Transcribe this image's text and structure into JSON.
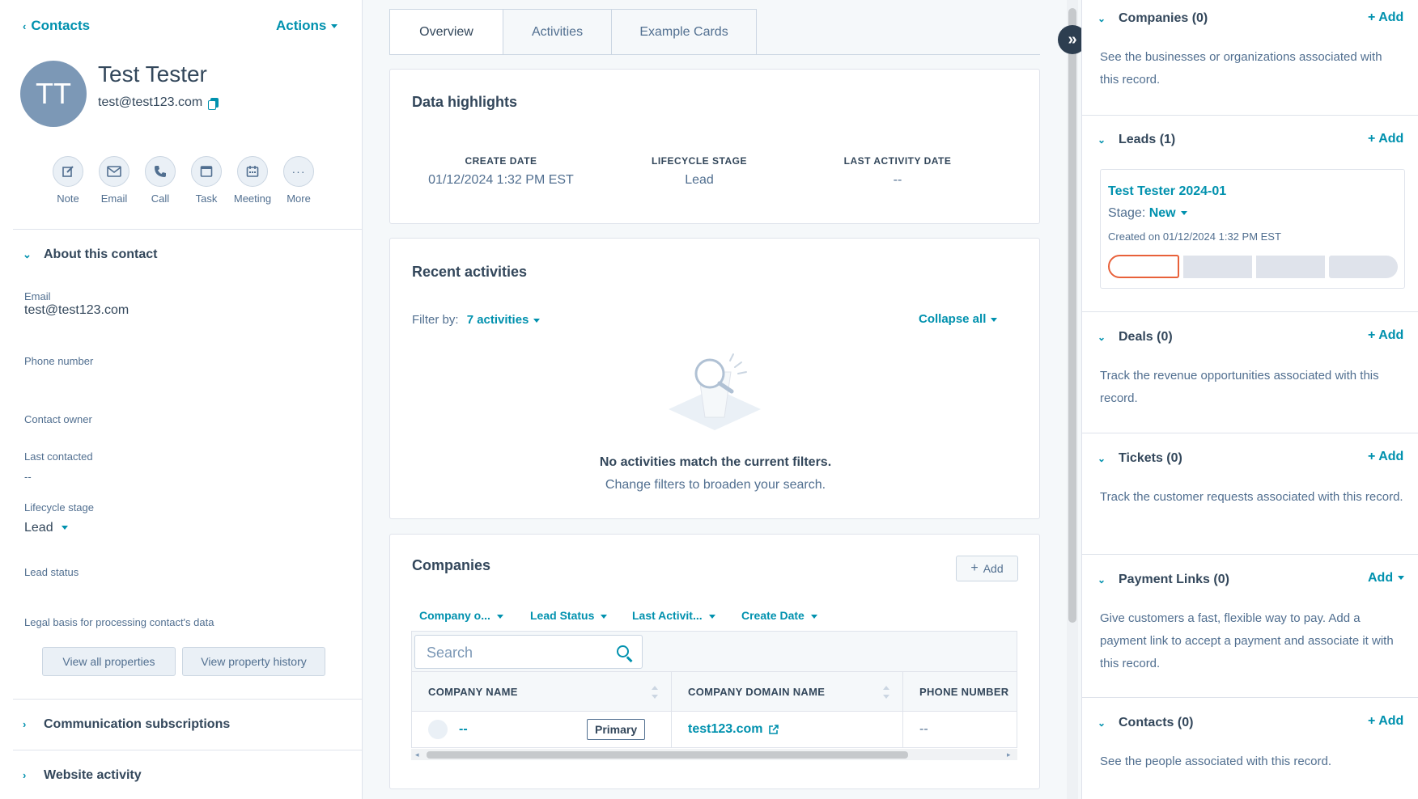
{
  "left": {
    "breadcrumb": "Contacts",
    "actions": "Actions",
    "avatar_initials": "TT",
    "name": "Test Tester",
    "email": "test@test123.com",
    "quick_actions": [
      {
        "label": "Note",
        "icon": "note-edit-icon"
      },
      {
        "label": "Email",
        "icon": "email-icon"
      },
      {
        "label": "Call",
        "icon": "phone-icon"
      },
      {
        "label": "Task",
        "icon": "task-icon"
      },
      {
        "label": "Meeting",
        "icon": "calendar-icon"
      },
      {
        "label": "More",
        "icon": "more-icon"
      }
    ],
    "about_title": "About this contact",
    "properties": {
      "email_label": "Email",
      "email_value": "test@test123.com",
      "phone_label": "Phone number",
      "owner_label": "Contact owner",
      "last_contacted_label": "Last contacted",
      "last_contacted_value": "--",
      "lifecycle_label": "Lifecycle stage",
      "lifecycle_value": "Lead",
      "lead_status_label": "Lead status",
      "legal_label": "Legal basis for processing contact's data"
    },
    "view_all": "View all properties",
    "view_history": "View property history",
    "comm_subscriptions": "Communication subscriptions",
    "website_activity": "Website activity"
  },
  "tabs": [
    "Overview",
    "Activities",
    "Example Cards"
  ],
  "highlights": {
    "title": "Data highlights",
    "items": [
      {
        "key": "CREATE DATE",
        "value": "01/12/2024 1:32 PM EST"
      },
      {
        "key": "LIFECYCLE STAGE",
        "value": "Lead"
      },
      {
        "key": "LAST ACTIVITY DATE",
        "value": "--"
      }
    ]
  },
  "recent": {
    "title": "Recent activities",
    "filter_label": "Filter by:",
    "filter_value": "7 activities",
    "collapse": "Collapse all",
    "empty_title": "No activities match the current filters.",
    "empty_sub": "Change filters to broaden your search."
  },
  "companies": {
    "title": "Companies",
    "add": "Add",
    "filters": [
      "Company o...",
      "Lead Status",
      "Last Activit...",
      "Create Date"
    ],
    "search_placeholder": "Search",
    "columns": [
      "COMPANY NAME",
      "COMPANY DOMAIN NAME",
      "PHONE NUMBER"
    ],
    "row": {
      "name": "--",
      "badge": "Primary",
      "domain": "test123.com",
      "phone": "--"
    }
  },
  "right": {
    "companies": {
      "title": "Companies (0)",
      "add": "+ Add",
      "text": "See the businesses or organizations associated with this record."
    },
    "leads": {
      "title": "Leads (1)",
      "add": "+ Add",
      "lead_name": "Test Tester 2024-01",
      "stage_label": "Stage:",
      "stage_value": "New",
      "created": "Created on 01/12/2024 1:32 PM EST"
    },
    "deals": {
      "title": "Deals (0)",
      "add": "+ Add",
      "text": "Track the revenue opportunities associated with this record."
    },
    "tickets": {
      "title": "Tickets (0)",
      "add": "+ Add",
      "text": "Track the customer requests associated with this record."
    },
    "payment": {
      "title": "Payment Links (0)",
      "add": "Add",
      "text": "Give customers a fast, flexible way to pay. Add a payment link to accept a payment and associate it with this record."
    },
    "contacts": {
      "title": "Contacts (0)",
      "add": "+ Add",
      "text": "See the people associated with this record."
    }
  },
  "colors": {
    "accent": "#0091ae",
    "avatar": "#7c98b6",
    "lead_stage": "#e8613a"
  }
}
